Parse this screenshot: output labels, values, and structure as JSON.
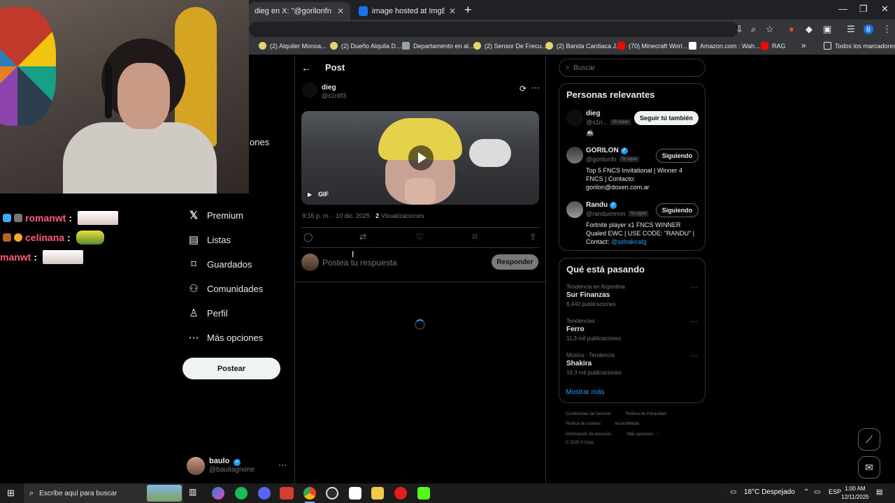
{
  "browser": {
    "tabs": [
      {
        "title": "dieg en X: \"@gorilonfn @randu",
        "active": true
      },
      {
        "title": "image hosted at ImgBB — Imgl",
        "active": false
      }
    ],
    "bookmarks": [
      "(2) Alquiler Monoa...",
      "(2) Dueño Alquila D...",
      "Departamento en al...",
      "(2) Sensor De Frecu...",
      "(2) Banda Cardiaca J...",
      "(70) Minecraft Worl...",
      "Amazon.com : Wah...",
      "RAG"
    ],
    "bookmarks_overflow": "»",
    "all_bookmarks": "Todos los marcadores",
    "profile_initial": "B"
  },
  "chat": [
    {
      "user": "romanwt",
      "colon": ":"
    },
    {
      "user": "celinana",
      "colon": ":"
    },
    {
      "user": "manwt",
      "colon": ":"
    }
  ],
  "x_nav": {
    "fragment": "ones",
    "items": [
      {
        "label": "Premium",
        "icon": "x-logo-icon"
      },
      {
        "label": "Listas",
        "icon": "lists-icon"
      },
      {
        "label": "Guardados",
        "icon": "bookmark-icon"
      },
      {
        "label": "Comunidades",
        "icon": "communities-icon"
      },
      {
        "label": "Perfil",
        "icon": "profile-icon"
      },
      {
        "label": "Más opciones",
        "icon": "more-options-icon"
      }
    ],
    "post_button": "Postear",
    "account": {
      "name": "baulo",
      "handle": "@bautiagnone",
      "more": "···"
    }
  },
  "post": {
    "back": "←",
    "header": "Post",
    "author_name": "dieg",
    "author_handle": "@s1nllf3",
    "media_badge": "GIF",
    "time": "9:16 p. m. · 10 dic. 2025 · ",
    "views_count": "2",
    "views_label": " Visualizaciones",
    "reply_placeholder": "Postea tu respuesta",
    "reply_button": "Responder"
  },
  "right": {
    "search_placeholder": "Buscar",
    "relevant_title": "Personas relevantes",
    "relevant": [
      {
        "name": "dieg",
        "handle": "@s1n...",
        "follows_you": "Te sigue",
        "extra": "",
        "bio": "",
        "button": "Seguir tú también",
        "verified": false
      },
      {
        "name": "GORILON",
        "handle": "@gorilonfn",
        "follows_you": "Te sigue",
        "bio": "Top 5 FNCS Invitational | Winner 4 FNCS | Contacto: gorilon@doxen.com.ar",
        "bio_link": "",
        "button": "Siguiendo",
        "verified": true
      },
      {
        "name": "Randu",
        "handle": "@randuimmm",
        "follows_you": "Te sigue",
        "bio": "Fortnite player x1 FNCS WINNER Qualed EWC | USE CODE: \"RANDU\" | Contact: ",
        "bio_link": "@sebakiratg",
        "button": "Siguiendo",
        "verified": true
      }
    ],
    "trends_title": "Qué está pasando",
    "trends": [
      {
        "context": "Tendencia en Argentina",
        "name": "Sur Finanzas",
        "count": "6.440 publicaciones"
      },
      {
        "context": "Tendencias",
        "name": "Ferro",
        "count": "11,3 mil publicaciones"
      },
      {
        "context": "Música · Tendencia",
        "name": "Shakira",
        "count": "19,3 mil publicaciones"
      }
    ],
    "show_more": "Mostrar más",
    "footer": [
      "Condiciones de Servicio",
      "Política de Privacidad",
      "Política de cookies",
      "Accesibilidad",
      "Información de anuncios",
      "Más opciones ···",
      "© 2025 X Corp."
    ]
  },
  "taskbar": {
    "search_placeholder": "Escribe aquí para buscar",
    "weather": "18°C  Despejado",
    "language": "ESP",
    "time": "1:00 AM",
    "date": "12/11/2025"
  }
}
